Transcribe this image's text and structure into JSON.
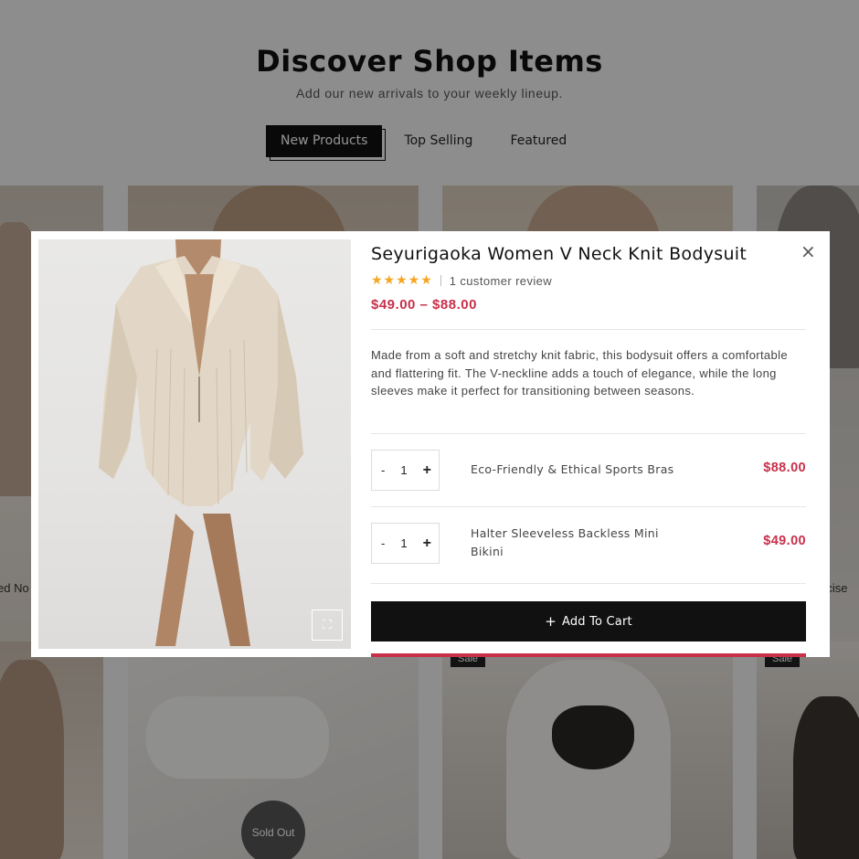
{
  "page": {
    "title": "Discover Shop Items",
    "subtitle": "Add our new arrivals to your weekly lineup.",
    "tabs": [
      {
        "label": "New Products",
        "active": true
      },
      {
        "label": "Top Selling",
        "active": false
      },
      {
        "label": "Featured",
        "active": false
      }
    ],
    "badges": {
      "sale": "Sale",
      "sold_out": "Sold Out"
    },
    "peek_left": "ed No",
    "peek_right": "rcise"
  },
  "modal": {
    "title": "Seyurigaoka Women V Neck Knit Bodysuit",
    "rating": {
      "stars": "★★★★★",
      "value": 5,
      "max": 5,
      "review_text": "1 customer review"
    },
    "price_range": "$49.00 – $88.00",
    "description": "Made from a soft and stretchy knit fabric, this bodysuit offers a comfortable and flattering fit. The V-neckline adds a touch of elegance, while the long sleeves make it perfect for transitioning between seasons.",
    "items": [
      {
        "name": "Eco-Friendly & Ethical Sports Bras",
        "price": "$88.00",
        "qty": "1",
        "minus": "-",
        "plus": "+"
      },
      {
        "name": "Halter Sleeveless Backless Mini Bikini",
        "price": "$49.00",
        "qty": "1",
        "minus": "-",
        "plus": "+"
      }
    ],
    "add_to_cart": {
      "icon": "+",
      "label": "Add To Cart"
    },
    "close": "×",
    "expand_icon": "⛶"
  },
  "colors": {
    "accent": "#c8304a",
    "star": "#f5a623",
    "dark": "#111111",
    "overlay": "rgba(0,0,0,0.42)"
  }
}
